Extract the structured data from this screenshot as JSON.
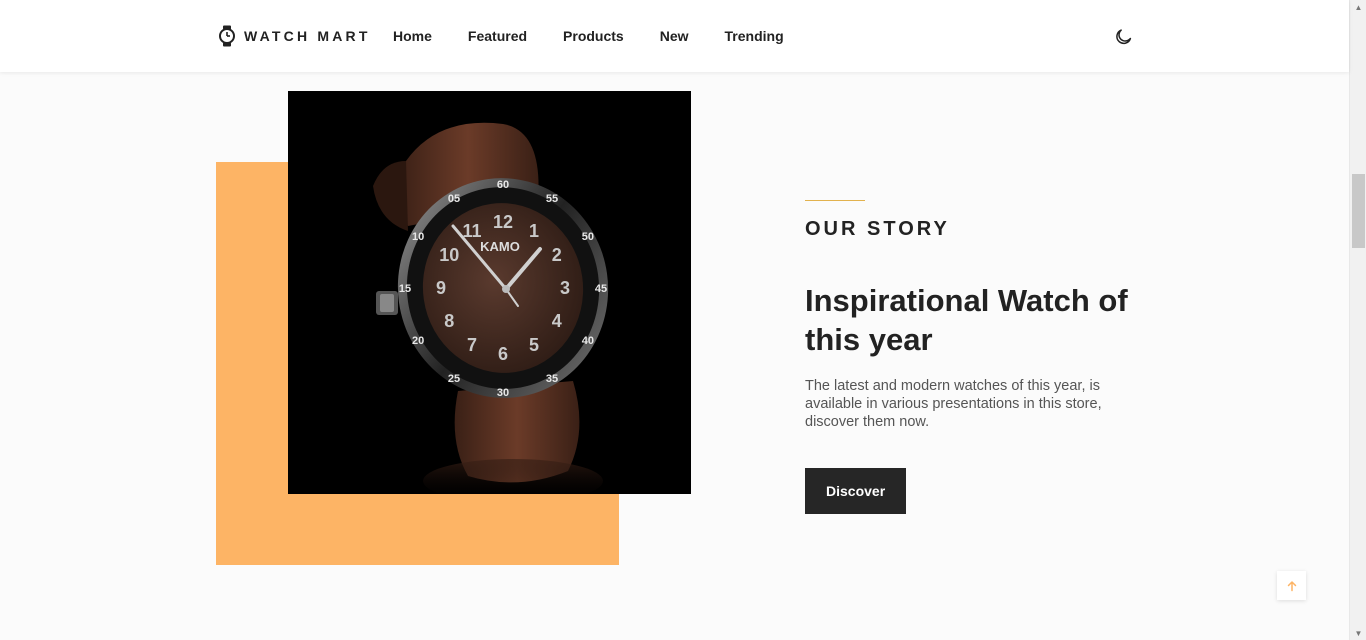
{
  "header": {
    "logo": {
      "text": "WATCH MART",
      "icon": "watch-icon"
    },
    "nav": [
      {
        "label": "Home"
      },
      {
        "label": "Featured"
      },
      {
        "label": "Products"
      },
      {
        "label": "New"
      },
      {
        "label": "Trending"
      }
    ],
    "theme_toggle_icon": "moon-icon"
  },
  "story": {
    "label": "OUR STORY",
    "title": "Inspirational Watch of this year",
    "description": "The latest and modern watches of this year, is available in various presentations in this store, discover them now.",
    "button_label": "Discover",
    "image_alt": "brown-wrist-watch",
    "image_text": {
      "brand": "KAMO",
      "dial_numbers": [
        "12",
        "11",
        "10",
        "9",
        "8",
        "7",
        "6",
        "5",
        "4",
        "3",
        "2",
        "1"
      ],
      "bezel_numbers": [
        "60",
        "55",
        "50",
        "45",
        "40",
        "35",
        "30",
        "25",
        "20",
        "15",
        "10",
        "05"
      ]
    }
  },
  "scroll_to_top_icon": "arrow-up-icon",
  "colors": {
    "accent_orange": "#fdb465",
    "accent_gold_line": "#e2b24e",
    "button_dark": "#262626",
    "text_dark": "#222222"
  }
}
